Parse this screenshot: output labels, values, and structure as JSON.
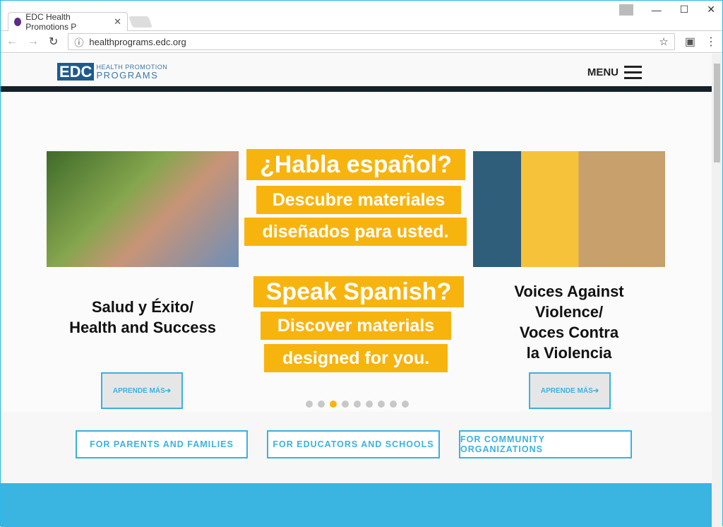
{
  "browser": {
    "tab_title": "EDC Health Promotions P",
    "url": "healthprograms.edc.org"
  },
  "logo": {
    "mark": "EDC",
    "line1": "HEALTH PROMOTION",
    "line2": "PROGRAMS"
  },
  "header": {
    "menu_label": "MENU"
  },
  "slides": {
    "left": {
      "caption_line1": "Salud y Éxito/",
      "caption_line2": "Health and Success",
      "button": "APRENDE MÁS➔"
    },
    "center": {
      "lines": [
        "¿Habla español?",
        "Descubre materiales",
        "diseñados para usted.",
        "Speak Spanish?",
        "Discover materials",
        "designed for you."
      ]
    },
    "right": {
      "caption_lines": [
        "Voices Against",
        "Violence/",
        "Voces Contra",
        "la Violencia"
      ],
      "button": "APRENDE MÁS➔"
    }
  },
  "carousel": {
    "total": 9,
    "active": 3,
    "active_color": "#f8b40e"
  },
  "audiences": [
    "FOR PARENTS AND FAMILIES",
    "FOR EDUCATORS AND SCHOOLS",
    "FOR COMMUNITY ORGANIZATIONS"
  ],
  "colors": {
    "accent": "#3bb1e1",
    "yellow": "#f8b40e",
    "brand": "#1e5b8c"
  }
}
